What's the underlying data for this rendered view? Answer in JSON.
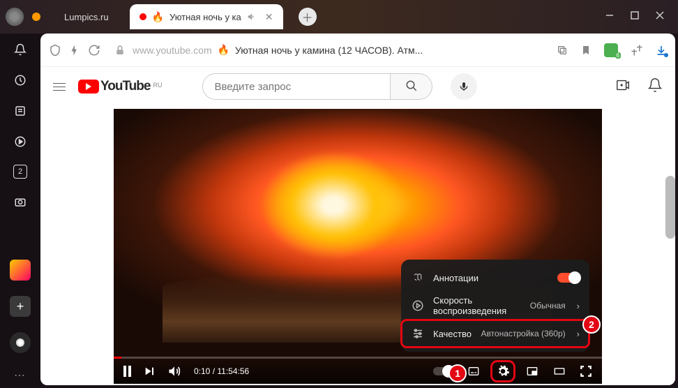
{
  "browser": {
    "tabs": [
      {
        "title": "Lumpics.ru",
        "active": false
      },
      {
        "title": "Уютная ночь у ка",
        "active": true
      }
    ],
    "addressbar": {
      "domain": "www.youtube.com",
      "page_title": "Уютная ночь у камина (12 ЧАСОВ). Атм..."
    },
    "dock_badge": "2"
  },
  "youtube": {
    "logo_text": "YouTube",
    "region": "RU",
    "search_placeholder": "Введите запрос"
  },
  "player": {
    "current_time": "0:10",
    "duration": "11:54:56",
    "time_display": "0:10 / 11:54:56",
    "settings_menu": {
      "annotations": {
        "label": "Аннотации",
        "enabled": true
      },
      "speed": {
        "label": "Скорость воспроизведения",
        "value": "Обычная"
      },
      "quality": {
        "label": "Качество",
        "value": "Автонастройка (360p)"
      }
    }
  },
  "callouts": {
    "badge1": "1",
    "badge2": "2"
  }
}
